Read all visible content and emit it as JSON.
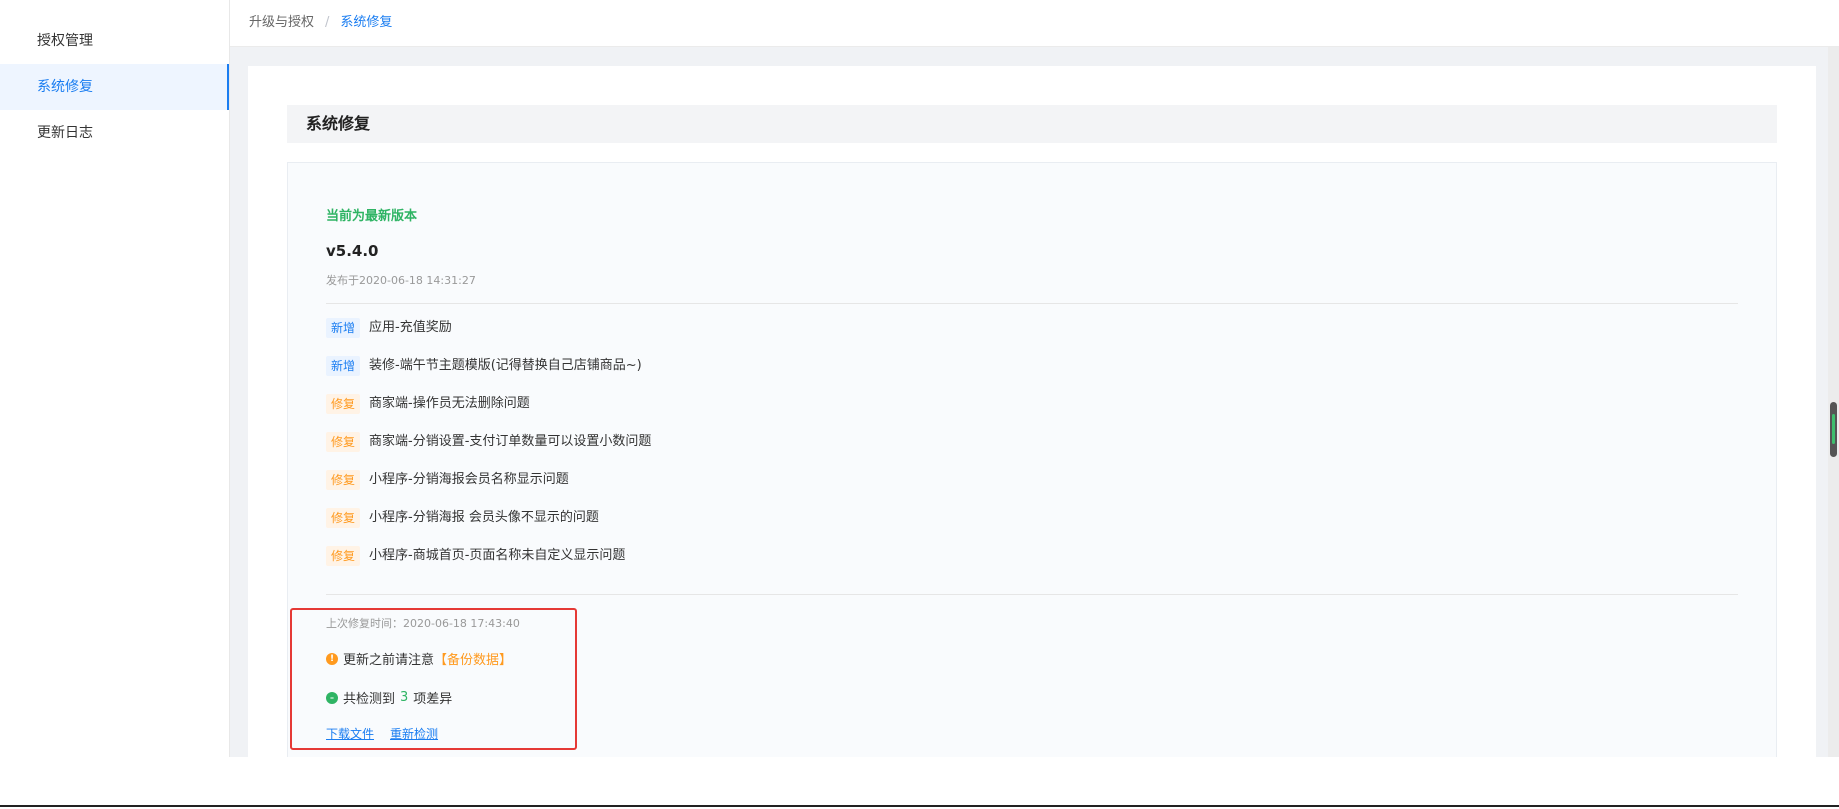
{
  "sidebar": {
    "items": [
      {
        "label": "授权管理",
        "active": false
      },
      {
        "label": "系统修复",
        "active": true
      },
      {
        "label": "更新日志",
        "active": false
      }
    ]
  },
  "breadcrumb": {
    "parent": "升级与授权",
    "separator": "/",
    "current": "系统修复"
  },
  "section": {
    "title": "系统修复"
  },
  "version_info": {
    "status": "当前为最新版本",
    "version": "v5.4.0",
    "release_date": "发布于2020-06-18 14:31:27"
  },
  "changes": [
    {
      "type": "new",
      "tag": "新增",
      "text": "应用-充值奖励"
    },
    {
      "type": "new",
      "tag": "新增",
      "text": "装修-端午节主题模版(记得替换自己店铺商品~)"
    },
    {
      "type": "fix",
      "tag": "修复",
      "text": "商家端-操作员无法删除问题"
    },
    {
      "type": "fix",
      "tag": "修复",
      "text": "商家端-分销设置-支付订单数量可以设置小数问题"
    },
    {
      "type": "fix",
      "tag": "修复",
      "text": "小程序-分销海报会员名称显示问题"
    },
    {
      "type": "fix",
      "tag": "修复",
      "text": "小程序-分销海报 会员头像不显示的问题"
    },
    {
      "type": "fix",
      "tag": "修复",
      "text": "小程序-商城首页-页面名称未自定义显示问题"
    }
  ],
  "repair": {
    "last_repair": "上次修复时间：2020-06-18 17:43:40",
    "notice_prefix": "更新之前请注意",
    "notice_highlight": "【备份数据】",
    "detect_prefix": "共检测到",
    "detect_count": "3",
    "detect_suffix": "项差异",
    "download_label": "下载文件",
    "recheck_label": "重新检测"
  },
  "colors": {
    "accent": "#1a7df1",
    "success": "#2fb464",
    "warning": "#ff9a1f",
    "highlight_box": "#e53935"
  },
  "icons": {
    "warning": "warning-icon",
    "success": "check-circle-icon"
  }
}
